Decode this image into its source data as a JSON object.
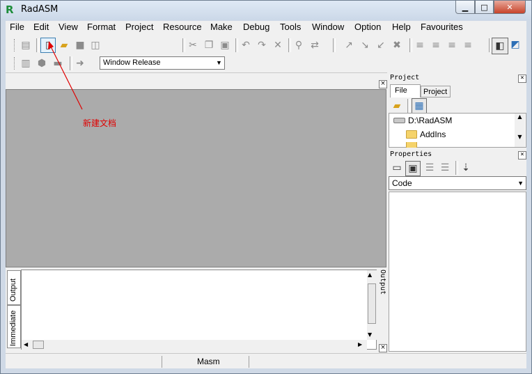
{
  "window": {
    "title": "RadASM",
    "app_icon_glyph": "R"
  },
  "caption_buttons": {
    "minimize": "▁",
    "maximize": "□",
    "close": "✕"
  },
  "menu": [
    "File",
    "Edit",
    "View",
    "Format",
    "Project",
    "Resource",
    "Make",
    "Debug",
    "Tools",
    "Window",
    "Option",
    "Help",
    "Favourites"
  ],
  "toolbar": {
    "build_config": "Window Release"
  },
  "output_panel": {
    "tabs": [
      "Output",
      "Immediate"
    ],
    "side_label": "Output"
  },
  "project_panel": {
    "title": "Project",
    "tabs": [
      "File",
      "Project"
    ],
    "tree": [
      {
        "label": "D:\\RadASM",
        "icon": "drive-icon"
      },
      {
        "label": "AddIns",
        "icon": "folder-icon"
      }
    ]
  },
  "properties_panel": {
    "title": "Properties",
    "selected": "Code"
  },
  "status": {
    "assembler": "Masm"
  },
  "annotation": {
    "text": "新建文档",
    "color": "#e00000"
  },
  "colors": {
    "mdi_background": "#ababab",
    "accent": "#3c7fb1"
  }
}
